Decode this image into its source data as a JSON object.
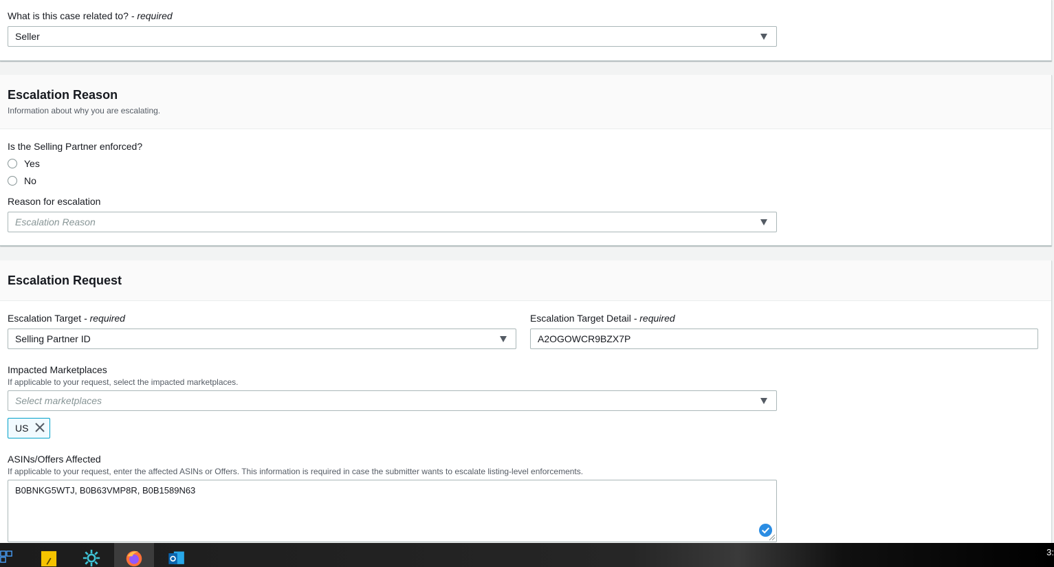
{
  "case_section": {
    "question_label": "What is this case related to?",
    "required_text": "- required",
    "selected_value": "Seller"
  },
  "escalation_reason": {
    "title": "Escalation Reason",
    "description": "Information about why you are escalating.",
    "enforced_question": "Is the Selling Partner enforced?",
    "option_yes": "Yes",
    "option_no": "No",
    "reason_label": "Reason for escalation",
    "reason_placeholder": "Escalation Reason"
  },
  "escalation_request": {
    "title": "Escalation Request",
    "target_label": "Escalation Target",
    "target_required": "- required",
    "target_value": "Selling Partner ID",
    "target_detail_label": "Escalation Target Detail",
    "target_detail_required": "- required",
    "target_detail_value": "A2OGOWCR9BZX7P",
    "marketplaces_label": "Impacted Marketplaces",
    "marketplaces_hint": "If applicable to your request, select the impacted marketplaces.",
    "marketplaces_placeholder": "Select marketplaces",
    "selected_marketplaces": [
      "US"
    ],
    "asins_label": "ASINs/Offers Affected",
    "asins_hint": "If applicable to your request, enter the affected ASINs or Offers. This information is required in case the submitter wants to escalate listing-level enforcements.",
    "asins_value": "B0BNKG5WTJ, B0B63VMP8R, B0B1589N63"
  },
  "taskbar": {
    "apps": [
      "windows-start-icon",
      "sticky-notes-icon",
      "settings-app-icon",
      "firefox-icon",
      "outlook-icon"
    ],
    "clock_partial": "3:"
  },
  "colors": {
    "accent": "#00a1c9",
    "check_blue": "#2b8de3"
  }
}
